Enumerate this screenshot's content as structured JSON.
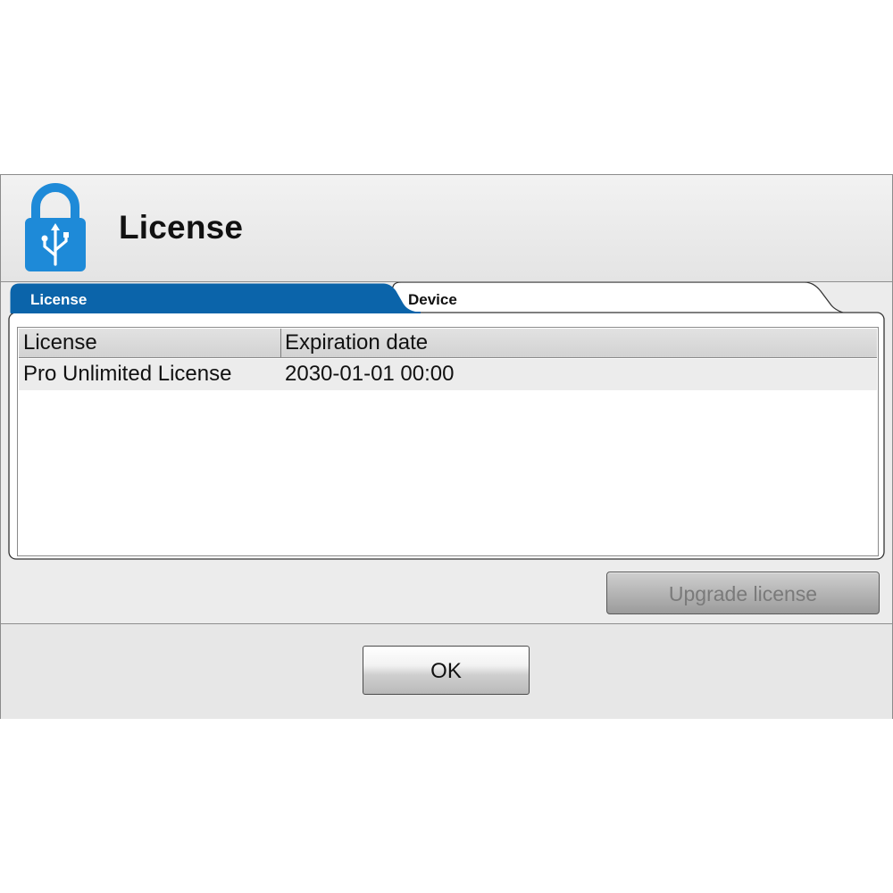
{
  "dialog": {
    "title": "License",
    "header_icon": "usb-lock-icon",
    "accent_color": "#0b64aa"
  },
  "tabs": [
    {
      "label": "License",
      "active": true
    },
    {
      "label": "Device",
      "active": false
    }
  ],
  "table": {
    "columns": [
      "License",
      "Expiration date"
    ],
    "rows": [
      [
        "Pro Unlimited License",
        "2030-01-01 00:00"
      ]
    ]
  },
  "buttons": {
    "upgrade_label": "Upgrade license",
    "ok_label": "OK"
  }
}
